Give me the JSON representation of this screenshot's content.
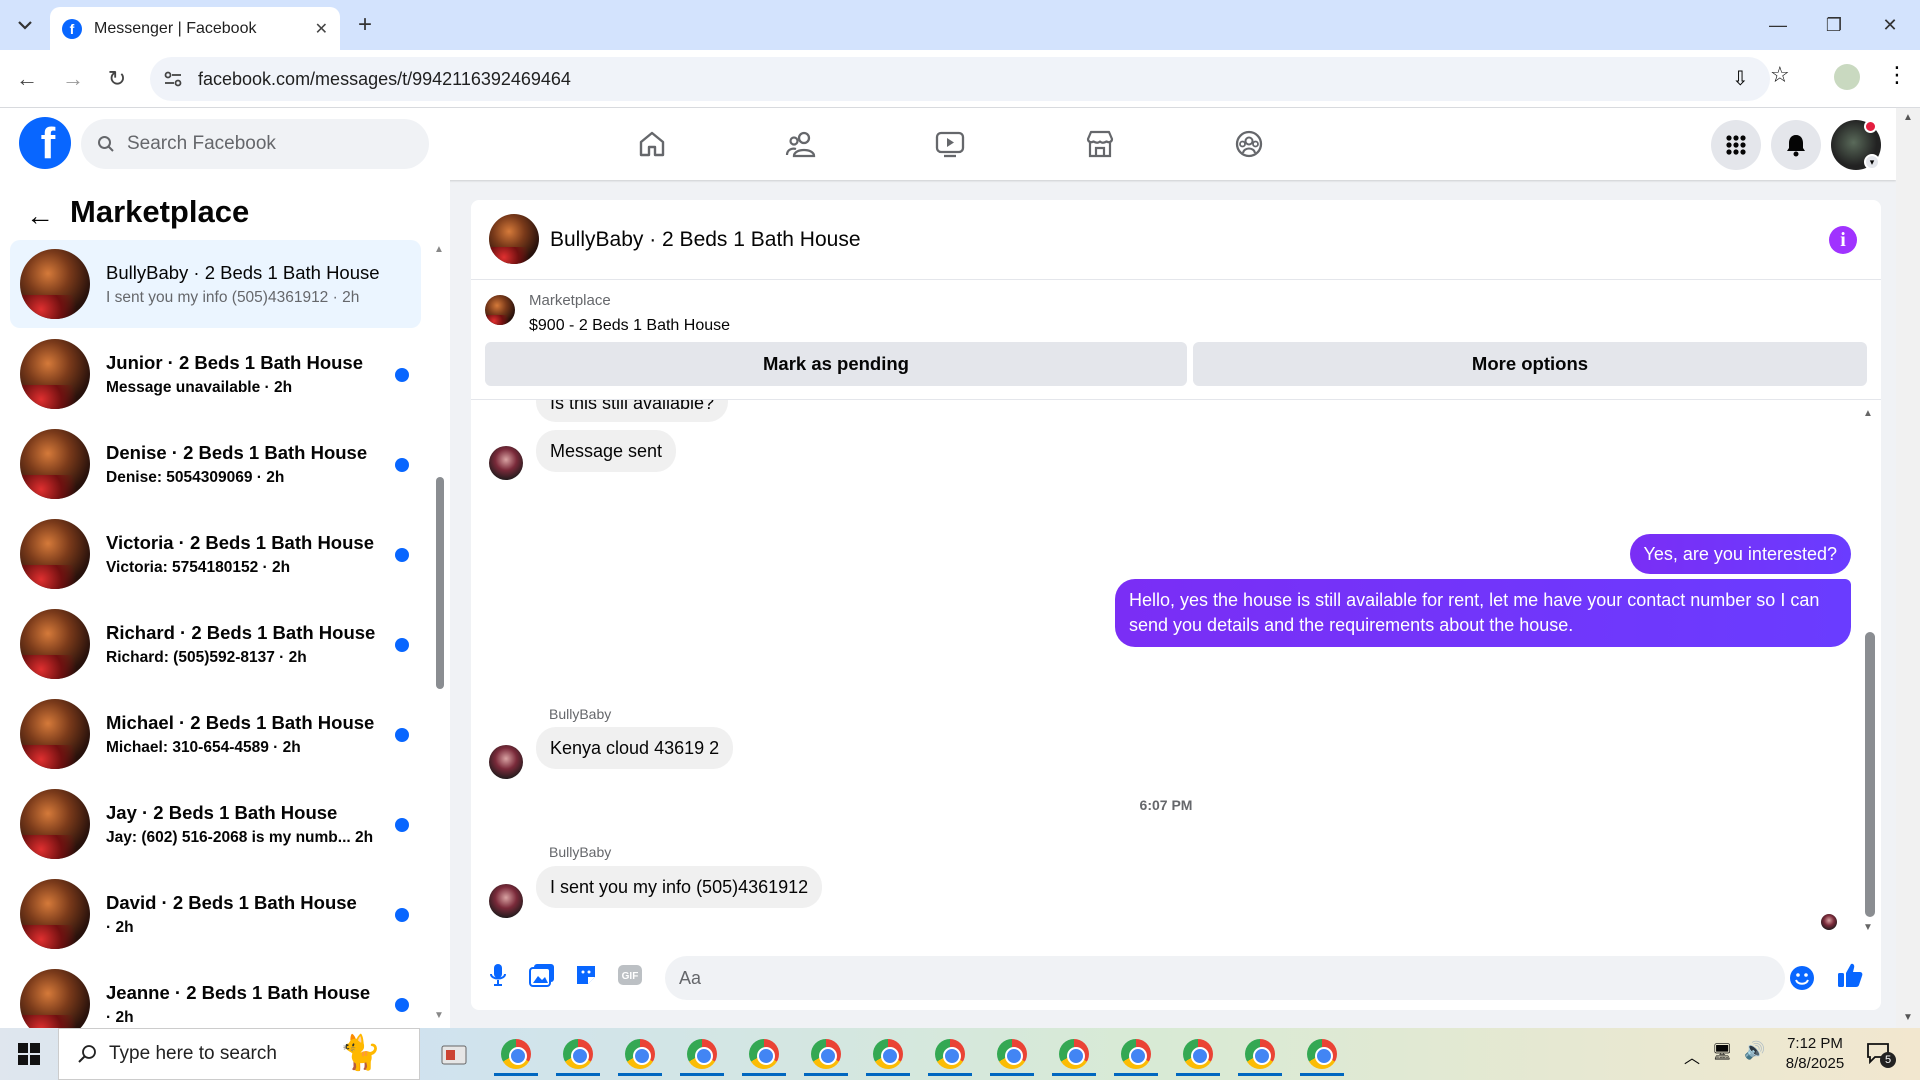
{
  "browser": {
    "tab_title": "Messenger | Facebook",
    "url": "facebook.com/messages/t/9942116392469464"
  },
  "fb": {
    "search_placeholder": "Search Facebook"
  },
  "left_panel": {
    "title": "Marketplace",
    "conversations": [
      {
        "name": "BullyBaby · 2 Beds 1 Bath House",
        "preview": "I sent you my info (505)4361912 · 2h",
        "selected": true,
        "unread": false
      },
      {
        "name": "Junior · 2 Beds 1 Bath House",
        "preview": "Message unavailable · 2h",
        "selected": false,
        "unread": true
      },
      {
        "name": "Denise · 2 Beds 1 Bath House",
        "preview": "Denise: 5054309069 · 2h",
        "selected": false,
        "unread": true
      },
      {
        "name": "Victoria · 2 Beds 1 Bath House",
        "preview": "Victoria: 5754180152 · 2h",
        "selected": false,
        "unread": true
      },
      {
        "name": "Richard · 2 Beds 1 Bath House",
        "preview": "Richard: (505)592-8137 · 2h",
        "selected": false,
        "unread": true
      },
      {
        "name": "Michael · 2 Beds 1 Bath House",
        "preview": "Michael: 310-654-4589 · 2h",
        "selected": false,
        "unread": true
      },
      {
        "name": "Jay · 2 Beds 1 Bath House",
        "preview": "Jay: (602) 516-2068 is my numb...   2h",
        "selected": false,
        "unread": true
      },
      {
        "name": "David · 2 Beds 1 Bath House",
        "preview": " · 2h",
        "selected": false,
        "unread": true
      },
      {
        "name": "Jeanne · 2 Beds 1 Bath House",
        "preview": " · 2h",
        "selected": false,
        "unread": true
      }
    ]
  },
  "chat": {
    "title": "BullyBaby · 2 Beds 1 Bath House",
    "marketplace_label": "Marketplace",
    "listing": "$900 - 2 Beds 1 Bath House",
    "mark_pending_label": "Mark as pending",
    "more_options_label": "More options",
    "messages": {
      "m0": "Is this still available?",
      "m1": "Message sent",
      "m2": "Yes, are you interested?",
      "m3": "Hello, yes the house is still available for rent, let me have your contact number so I can send you details and the requirements about the house.",
      "sender1": "BullyBaby",
      "m4": "Kenya cloud 43619 2",
      "timestamp": "6:07 PM",
      "sender2": "BullyBaby",
      "m5": "I sent you my info (505)4361912"
    },
    "input_placeholder": "Aa"
  },
  "taskbar": {
    "search_placeholder": "Type here to search",
    "time": "7:12 PM",
    "date": "8/8/2025",
    "notification_count": "5"
  }
}
